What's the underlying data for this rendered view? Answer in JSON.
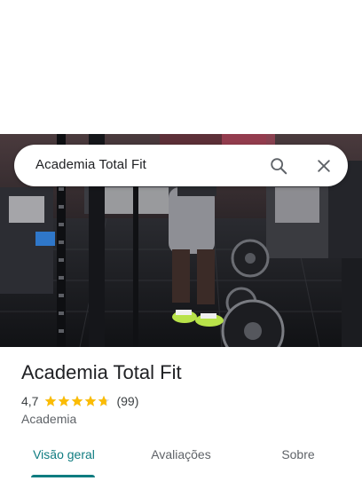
{
  "search": {
    "query": "Academia Total Fit"
  },
  "place": {
    "name": "Academia Total Fit",
    "rating": "4,7",
    "rating_value": 4.7,
    "review_count": "(99)",
    "category": "Academia",
    "star_color": "#fbbc04"
  },
  "tabs": [
    {
      "label": "Visão geral",
      "active": true
    },
    {
      "label": "Avaliações",
      "active": false
    },
    {
      "label": "Sobre",
      "active": false
    }
  ],
  "colors": {
    "accent": "#0f7c80"
  },
  "icons": {
    "search": "search-icon",
    "close": "close-icon",
    "star": "star-icon"
  }
}
